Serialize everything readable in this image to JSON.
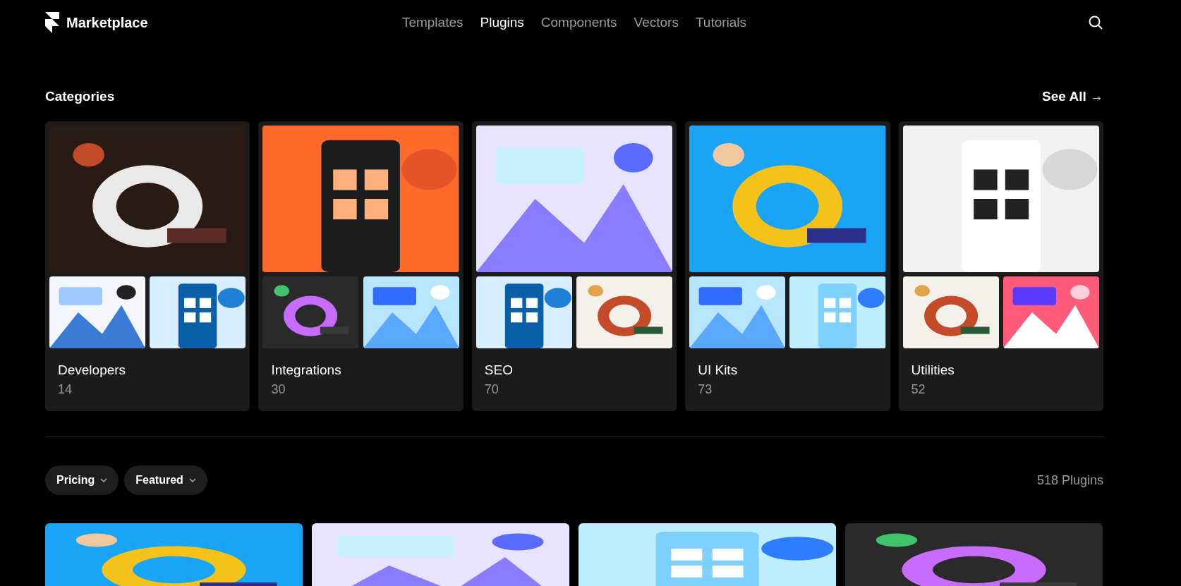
{
  "header": {
    "brand": "Marketplace",
    "nav": [
      {
        "label": "Templates",
        "selected": false
      },
      {
        "label": "Plugins",
        "selected": true
      },
      {
        "label": "Components",
        "selected": false
      },
      {
        "label": "Vectors",
        "selected": false
      },
      {
        "label": "Tutorials",
        "selected": false
      }
    ]
  },
  "categories": {
    "title": "Categories",
    "see_all": "See All →",
    "items": [
      {
        "name": "Developers",
        "count": "14"
      },
      {
        "name": "Integrations",
        "count": "30"
      },
      {
        "name": "SEO",
        "count": "70"
      },
      {
        "name": "UI Kits",
        "count": "73"
      },
      {
        "name": "Utilities",
        "count": "52"
      }
    ]
  },
  "filters": [
    {
      "label": "Pricing"
    },
    {
      "label": "Featured"
    }
  ],
  "plugin_count": "518 Plugins"
}
